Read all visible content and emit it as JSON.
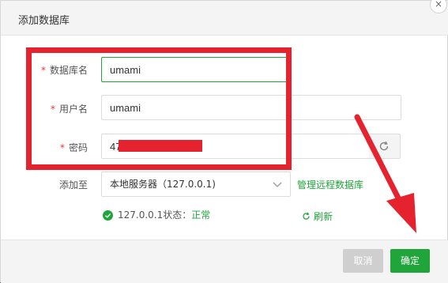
{
  "dialog": {
    "title": "添加数据库",
    "close_glyph": "×"
  },
  "form": {
    "db_name": {
      "label": "数据库名",
      "value": "umami",
      "required": true
    },
    "username": {
      "label": "用户名",
      "value": "umami",
      "required": true
    },
    "password": {
      "label": "密码",
      "value_visible": "47",
      "required": true,
      "refresh_icon": "refresh-icon"
    },
    "add_to": {
      "label": "添加至",
      "selected": "本地服务器（127.0.0.1)",
      "manage_link": "管理远程数据库"
    },
    "status": {
      "prefix": "127.0.0.1状态：",
      "value": "正常",
      "refresh_link": "刷新"
    }
  },
  "footer": {
    "cancel_label": "取消",
    "ok_label": "确定"
  },
  "colors": {
    "accent": "#20a53a",
    "annotation": "#e5232f"
  }
}
